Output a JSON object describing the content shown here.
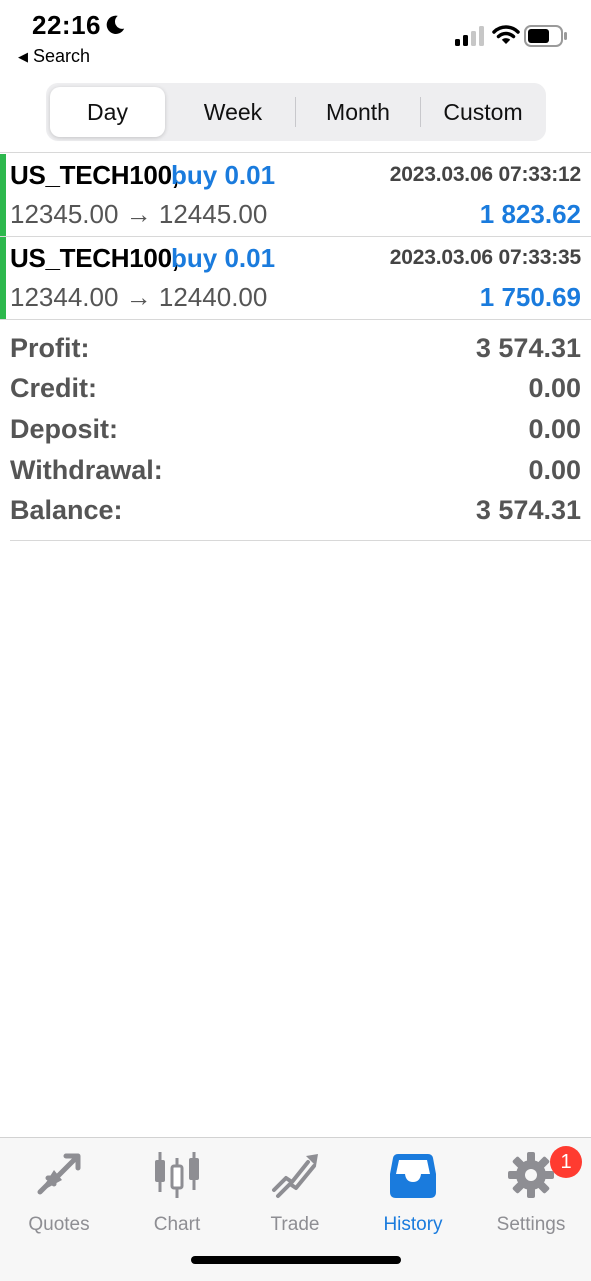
{
  "status_bar": {
    "time": "22:16",
    "back_label": "Search"
  },
  "segments": [
    {
      "label": "Day",
      "active": true
    },
    {
      "label": "Week",
      "active": false
    },
    {
      "label": "Month",
      "active": false
    },
    {
      "label": "Custom",
      "active": false
    }
  ],
  "deals": [
    {
      "symbol": "US_TECH100,",
      "side": "buy 0.01",
      "time": "2023.03.06 07:33:12",
      "prices": "12345.00 → 12445.00",
      "profit": "1 823.62"
    },
    {
      "symbol": "US_TECH100,",
      "side": "buy 0.01",
      "time": "2023.03.06 07:33:35",
      "prices": "12344.00 → 12440.00",
      "profit": "1 750.69"
    }
  ],
  "summary": [
    {
      "label": "Profit:",
      "value": "3 574.31"
    },
    {
      "label": "Credit:",
      "value": "0.00"
    },
    {
      "label": "Deposit:",
      "value": "0.00"
    },
    {
      "label": "Withdrawal:",
      "value": "0.00"
    },
    {
      "label": "Balance:",
      "value": "3 574.31"
    }
  ],
  "tabs": [
    {
      "label": "Quotes",
      "icon": "quotes-icon",
      "active": false
    },
    {
      "label": "Chart",
      "icon": "chart-icon",
      "active": false
    },
    {
      "label": "Trade",
      "icon": "trade-icon",
      "active": false
    },
    {
      "label": "History",
      "icon": "history-icon",
      "active": true
    },
    {
      "label": "Settings",
      "icon": "gear-icon",
      "active": false,
      "badge": "1"
    }
  ],
  "colors": {
    "accent": "#1a7bdd",
    "buy_bar": "#2db84d",
    "badge": "#ff3b30",
    "inactive_tab": "#8e8e93"
  }
}
